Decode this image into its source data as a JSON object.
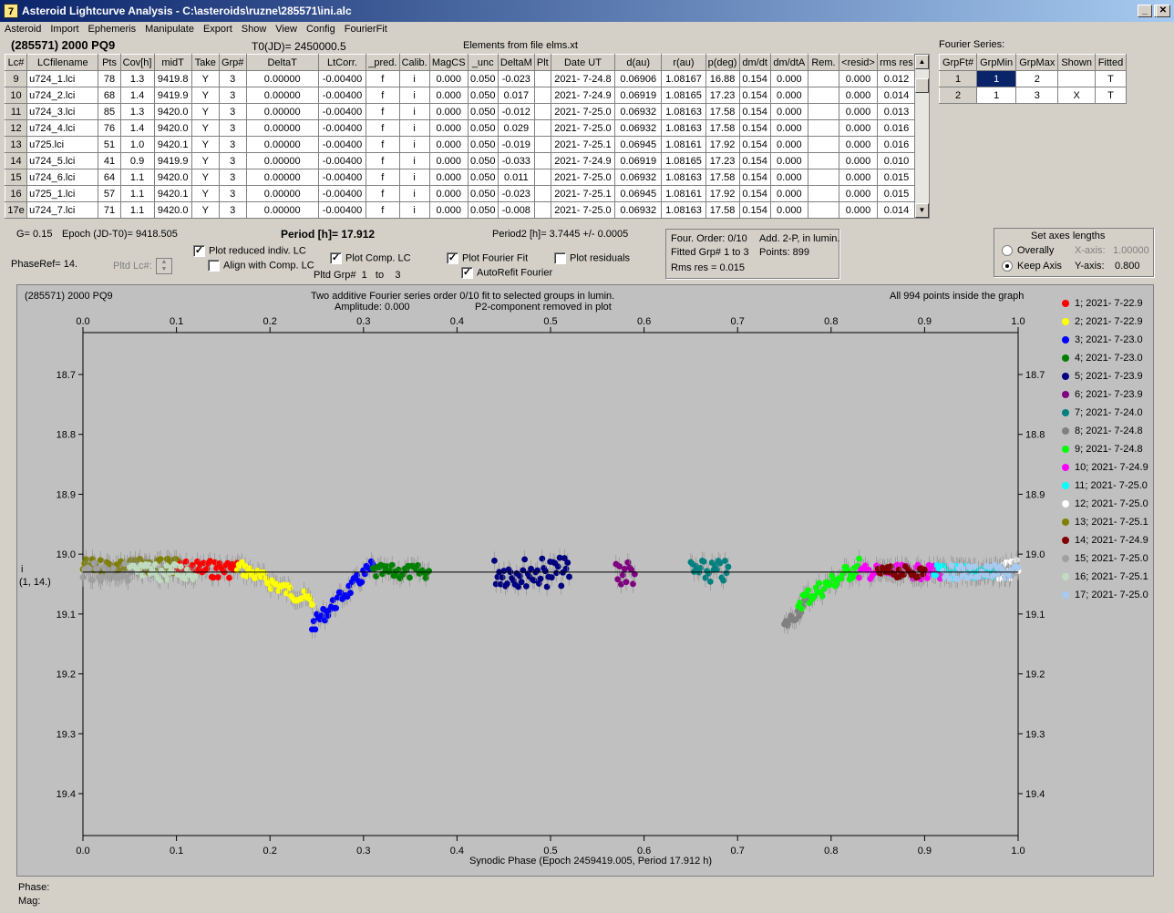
{
  "window": {
    "title": "Asteroid Lightcurve Analysis - C:\\asteroids\\ruzne\\285571\\ini.alc",
    "icon": "7",
    "minimize": "_",
    "maximize": "□",
    "close": "✕"
  },
  "menu": [
    "Asteroid",
    "Import",
    "Ephemeris",
    "Manipulate",
    "Export",
    "Show",
    "View",
    "Config",
    "FourierFit"
  ],
  "header": {
    "object": "(285571) 2000 PQ9",
    "t0": "T0(JD)= 2450000.5",
    "elements": "Elements from file elms.xt"
  },
  "table": {
    "columns": [
      "Lc#",
      "LCfilename",
      "Pts",
      "Cov[h]",
      "midT",
      "Take",
      "Grp#",
      "DeltaT",
      "LtCorr.",
      "_pred.",
      "Calib.",
      "MagCS",
      "_unc",
      "DeltaM",
      "Plt",
      "Date UT",
      "d(au)",
      "r(au)",
      "p(deg)",
      "dm/dt",
      "dm/dtA",
      "Rem.",
      "<resid>",
      "rms res"
    ],
    "rows": [
      [
        "9",
        "u724_1.lci",
        "78",
        "1.3",
        "9419.8",
        "Y",
        "3",
        "0.00000",
        "-0.00400",
        "f",
        "i",
        "0.000",
        "0.050",
        "-0.023",
        "",
        "2021- 7-24.8",
        "0.06906",
        "1.08167",
        "16.88",
        "0.154",
        "0.000",
        "",
        "0.000",
        "0.012"
      ],
      [
        "10",
        "u724_2.lci",
        "68",
        "1.4",
        "9419.9",
        "Y",
        "3",
        "0.00000",
        "-0.00400",
        "f",
        "i",
        "0.000",
        "0.050",
        "0.017",
        "",
        "2021- 7-24.9",
        "0.06919",
        "1.08165",
        "17.23",
        "0.154",
        "0.000",
        "",
        "0.000",
        "0.014"
      ],
      [
        "11",
        "u724_3.lci",
        "85",
        "1.3",
        "9420.0",
        "Y",
        "3",
        "0.00000",
        "-0.00400",
        "f",
        "i",
        "0.000",
        "0.050",
        "-0.012",
        "",
        "2021- 7-25.0",
        "0.06932",
        "1.08163",
        "17.58",
        "0.154",
        "0.000",
        "",
        "0.000",
        "0.013"
      ],
      [
        "12",
        "u724_4.lci",
        "76",
        "1.4",
        "9420.0",
        "Y",
        "3",
        "0.00000",
        "-0.00400",
        "f",
        "i",
        "0.000",
        "0.050",
        "0.029",
        "",
        "2021- 7-25.0",
        "0.06932",
        "1.08163",
        "17.58",
        "0.154",
        "0.000",
        "",
        "0.000",
        "0.016"
      ],
      [
        "13",
        "u725.lci",
        "51",
        "1.0",
        "9420.1",
        "Y",
        "3",
        "0.00000",
        "-0.00400",
        "f",
        "i",
        "0.000",
        "0.050",
        "-0.019",
        "",
        "2021- 7-25.1",
        "0.06945",
        "1.08161",
        "17.92",
        "0.154",
        "0.000",
        "",
        "0.000",
        "0.016"
      ],
      [
        "14",
        "u724_5.lci",
        "41",
        "0.9",
        "9419.9",
        "Y",
        "3",
        "0.00000",
        "-0.00400",
        "f",
        "i",
        "0.000",
        "0.050",
        "-0.033",
        "",
        "2021- 7-24.9",
        "0.06919",
        "1.08165",
        "17.23",
        "0.154",
        "0.000",
        "",
        "0.000",
        "0.010"
      ],
      [
        "15",
        "u724_6.lci",
        "64",
        "1.1",
        "9420.0",
        "Y",
        "3",
        "0.00000",
        "-0.00400",
        "f",
        "i",
        "0.000",
        "0.050",
        "0.011",
        "",
        "2021- 7-25.0",
        "0.06932",
        "1.08163",
        "17.58",
        "0.154",
        "0.000",
        "",
        "0.000",
        "0.015"
      ],
      [
        "16",
        "u725_1.lci",
        "57",
        "1.1",
        "9420.1",
        "Y",
        "3",
        "0.00000",
        "-0.00400",
        "f",
        "i",
        "0.000",
        "0.050",
        "-0.023",
        "",
        "2021- 7-25.1",
        "0.06945",
        "1.08161",
        "17.92",
        "0.154",
        "0.000",
        "",
        "0.000",
        "0.015"
      ],
      [
        "17e",
        "u724_7.lci",
        "71",
        "1.1",
        "9420.0",
        "Y",
        "3",
        "0.00000",
        "-0.00400",
        "f",
        "i",
        "0.000",
        "0.050",
        "-0.008",
        "",
        "2021- 7-25.0",
        "0.06932",
        "1.08163",
        "17.58",
        "0.154",
        "0.000",
        "",
        "0.000",
        "0.014"
      ]
    ]
  },
  "fourier_series": {
    "label": "Fourier Series:",
    "columns": [
      "GrpFt#",
      "GrpMin",
      "GrpMax",
      "Shown",
      "Fitted"
    ],
    "rows": [
      [
        "1",
        "1",
        "2",
        "",
        "T"
      ],
      [
        "2",
        "1",
        "3",
        "X",
        "T"
      ]
    ]
  },
  "params": {
    "g": "G= 0.15",
    "epoch": "Epoch (JD-T0)= 9418.505",
    "period": "Period [h]= 17.912",
    "period2": "Period2 [h]= 3.7445 +/- 0.0005",
    "phase_ref": "PhaseRef= 14.",
    "pltd_lc": "Pltd Lc#:",
    "pltd_grp": "Pltd Grp#",
    "grp_from": "1",
    "grp_to_word": "to",
    "grp_to": "3"
  },
  "options": {
    "plot_reduced": "Plot reduced indiv. LC",
    "align_comp": "Align with Comp. LC",
    "plot_comp": "Plot Comp. LC",
    "plot_fourier": "Plot Fourier Fit",
    "autorefit": "AutoRefit Fourier",
    "plot_residuals": "Plot residuals",
    "checked_mark": "✓"
  },
  "fit_info": {
    "order": "Four. Order:  0/10",
    "add": "Add. 2-P, in lumin.",
    "fitted": "Fitted Grp# 1 to 3",
    "points": "Points: 899",
    "rms": "Rms res      = 0.015"
  },
  "axes_lengths": {
    "title": "Set axes lengths",
    "overally": "Overally",
    "keep": "Keep Axis",
    "xaxis_label": "X-axis:",
    "xaxis_value": "1.00000",
    "yaxis_label": "Y-axis:",
    "yaxis_value": "0.800",
    "selected": "keep"
  },
  "plot": {
    "title_left": "(285571) 2000 PQ9",
    "title_center1": "Two additive Fourier series order 0/10 fit to selected groups in lumin.",
    "title_center2": "Amplitude: 0.000",
    "title_center3": "P2-component removed in plot",
    "title_right": "All 994 points inside the graph",
    "ylabel1": "i",
    "ylabel2": "(1, 14.)",
    "xlabel": "Synodic Phase (Epoch 2459419.005, Period 17.912 h)"
  },
  "chart_data": {
    "type": "scatter",
    "xlim": [
      0,
      1
    ],
    "ylim": [
      19.47,
      18.63
    ],
    "y_inverted": true,
    "xticks": [
      "0.0",
      "0.1",
      "0.2",
      "0.3",
      "0.4",
      "0.5",
      "0.6",
      "0.7",
      "0.8",
      "0.9",
      "1.0"
    ],
    "yticks": [
      "18.7",
      "18.8",
      "18.9",
      "19.0",
      "19.1",
      "19.2",
      "19.3",
      "19.4"
    ],
    "fit_line_y": 19.03,
    "series": [
      {
        "name": "1; 2021- 7-22.9",
        "color": "#ff0000",
        "x": [
          0.1,
          0.165
        ],
        "y": [
          19.025,
          19.025
        ],
        "spread": 0.015
      },
      {
        "name": "2; 2021- 7-22.9",
        "color": "#ffff00",
        "x": [
          0.165,
          0.245
        ],
        "y": [
          19.02,
          19.08
        ],
        "spread": 0.012
      },
      {
        "name": "3; 2021- 7-23.0",
        "color": "#0000ff",
        "x": [
          0.245,
          0.31
        ],
        "y": [
          19.12,
          19.02
        ],
        "spread": 0.012
      },
      {
        "name": "4; 2021- 7-23.0",
        "color": "#008000",
        "x": [
          0.31,
          0.37
        ],
        "y": [
          19.03,
          19.03
        ],
        "spread": 0.012
      },
      {
        "name": "5; 2021- 7-23.9",
        "color": "#000080",
        "x": [
          0.44,
          0.52
        ],
        "y": [
          19.03,
          19.03
        ],
        "spread": 0.025
      },
      {
        "name": "6; 2021- 7-23.9",
        "color": "#800080",
        "x": [
          0.57,
          0.59
        ],
        "y": [
          19.03,
          19.03
        ],
        "spread": 0.025
      },
      {
        "name": "7; 2021- 7-24.0",
        "color": "#008080",
        "x": [
          0.65,
          0.69
        ],
        "y": [
          19.03,
          19.03
        ],
        "spread": 0.02
      },
      {
        "name": "8; 2021- 7-24.8",
        "color": "#808080",
        "x": [
          0.75,
          0.775
        ],
        "y": [
          19.12,
          19.08
        ],
        "spread": 0.01
      },
      {
        "name": "9; 2021- 7-24.8",
        "color": "#00ff00",
        "x": [
          0.765,
          0.83
        ],
        "y": [
          19.08,
          19.02
        ],
        "spread": 0.015
      },
      {
        "name": "10; 2021- 7-24.9",
        "color": "#ff00ff",
        "x": [
          0.83,
          0.92
        ],
        "y": [
          19.03,
          19.03
        ],
        "spread": 0.012
      },
      {
        "name": "11; 2021- 7-25.0",
        "color": "#00ffff",
        "x": [
          0.91,
          0.98
        ],
        "y": [
          19.03,
          19.03
        ],
        "spread": 0.012
      },
      {
        "name": "12; 2021- 7-25.0",
        "color": "#ffffff",
        "x": [
          0.98,
          1.0
        ],
        "y": [
          19.03,
          19.03
        ],
        "spread": 0.02
      },
      {
        "name": "13; 2021- 7-25.1",
        "color": "#808000",
        "x": [
          0.0,
          0.1
        ],
        "y": [
          19.02,
          19.02
        ],
        "spread": 0.012
      },
      {
        "name": "14; 2021- 7-24.9",
        "color": "#800000",
        "x": [
          0.85,
          0.9
        ],
        "y": [
          19.03,
          19.03
        ],
        "spread": 0.01
      },
      {
        "name": "15; 2021- 7-25.0",
        "color": "#a0a0a0",
        "x": [
          0.0,
          0.06
        ],
        "y": [
          19.03,
          19.03
        ],
        "spread": 0.015
      },
      {
        "name": "16; 2021- 7-25.1",
        "color": "#c0dcc0",
        "x": [
          0.05,
          0.12
        ],
        "y": [
          19.03,
          19.03
        ],
        "spread": 0.015
      },
      {
        "name": "17; 2021- 7-25.0",
        "color": "#a6caf0",
        "x": [
          0.92,
          1.0
        ],
        "y": [
          19.03,
          19.03
        ],
        "spread": 0.012
      }
    ]
  },
  "status": {
    "phase": "Phase:",
    "mag": "Mag:"
  }
}
